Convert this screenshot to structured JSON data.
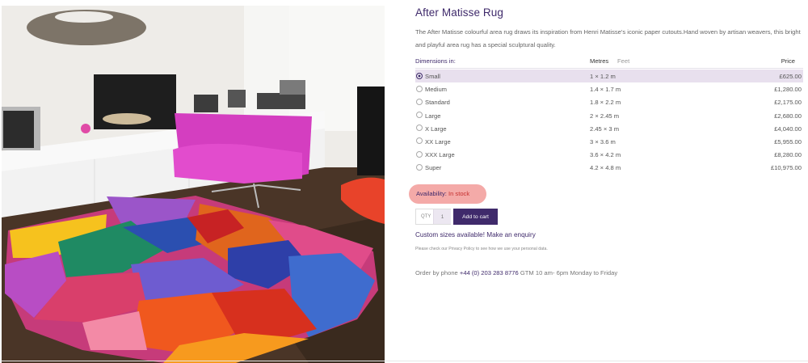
{
  "product": {
    "title": "After Matisse Rug",
    "description": "The After Matisse colourful area rug draws its inspiration from Henri Matisse's iconic paper cutouts.Hand woven by artisan weavers, this bright and playful area rug has a special sculptural quality."
  },
  "dimensions": {
    "label": "Dimensions in:",
    "unit_metres": "Metres",
    "unit_feet": "Feet",
    "price_label": "Price",
    "selected_index": 0,
    "sizes": [
      {
        "name": "Small",
        "dims": "1 × 1.2 m",
        "price": "£625.00"
      },
      {
        "name": "Medium",
        "dims": "1.4 × 1.7 m",
        "price": "£1,280.00"
      },
      {
        "name": "Standard",
        "dims": "1.8 × 2.2 m",
        "price": "£2,175.00"
      },
      {
        "name": "Large",
        "dims": "2 × 2.45 m",
        "price": "£2,680.00"
      },
      {
        "name": "X Large",
        "dims": "2.45 × 3 m",
        "price": "£4,040.00"
      },
      {
        "name": "XX Large",
        "dims": "3 × 3.6 m",
        "price": "£5,955.00"
      },
      {
        "name": "XXX Large",
        "dims": "3.6 × 4.2 m",
        "price": "£8,280.00"
      },
      {
        "name": "Super",
        "dims": "4.2 × 4.8 m",
        "price": "£10,975.00"
      }
    ]
  },
  "availability": {
    "label": "Availability:",
    "value": "In stock"
  },
  "purchase": {
    "qty_label": "QTY",
    "qty_value": "1",
    "add_to_cart": "Add to cart"
  },
  "custom_sizes": "Custom sizes available! Make an enquiry",
  "privacy_note": "Please check our Privacy Policy to see how we use your personal data.",
  "order": {
    "prefix": "Order by phone",
    "phone": "+44 (0) 203 283 8776",
    "suffix": "GTM 10 am- 6pm Monday to Friday"
  },
  "colors": {
    "brand": "#3f2a6b",
    "selected_row": "#e8e0ee",
    "availability_highlight": "#f4aaa8",
    "stock": "#c63030"
  }
}
